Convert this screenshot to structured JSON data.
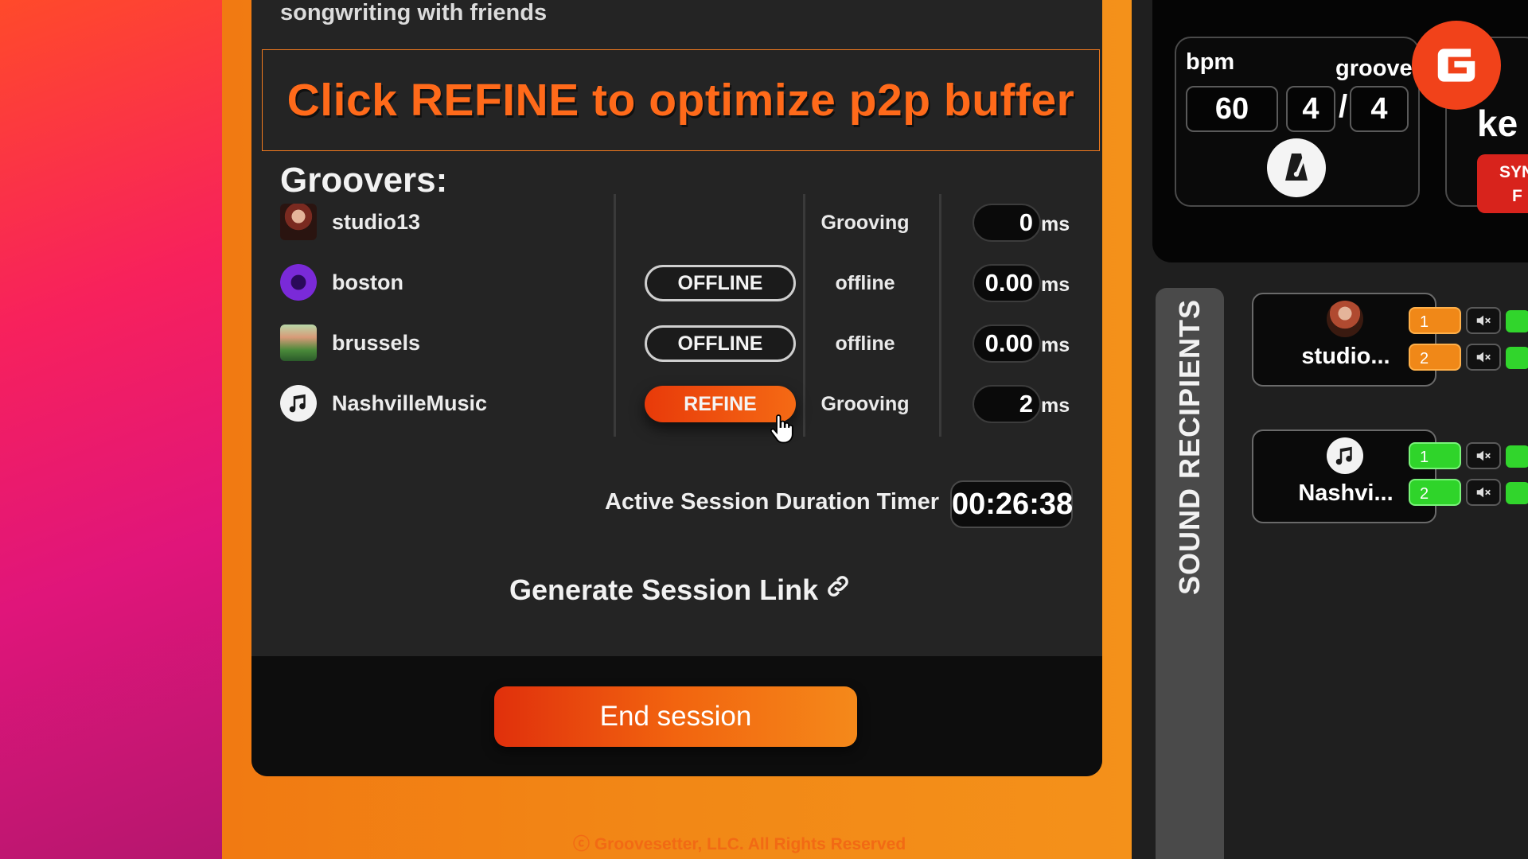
{
  "session": {
    "subtitle": "songwriting with friends",
    "banner": "Click REFINE to optimize p2p buffer",
    "groovers_heading": "Groovers:",
    "groovers": [
      {
        "name": "studio13",
        "button": "",
        "status": "Grooving",
        "latency": "0",
        "unit": "ms",
        "avatar": "photo-avatar"
      },
      {
        "name": "boston",
        "button": "OFFLINE",
        "status": "offline",
        "latency": "0.00",
        "unit": "ms",
        "avatar": "logo-avatar"
      },
      {
        "name": "brussels",
        "button": "OFFLINE",
        "status": "offline",
        "latency": "0.00",
        "unit": "ms",
        "avatar": "photo-avatar"
      },
      {
        "name": "NashvilleMusic",
        "button": "REFINE",
        "status": "Grooving",
        "latency": "2",
        "unit": "ms",
        "avatar": "music-note-icon"
      }
    ],
    "timer_label": "Active Session Duration Timer",
    "timer_value": "00:26:38",
    "session_link_label": "Generate Session Link",
    "end_session_label": "End session",
    "copyright": "ⓒ Groovesetter, LLC.  All Rights Reserved"
  },
  "tempo": {
    "bpm_label": "bpm",
    "bpm_value": "60",
    "groove_label": "groove",
    "beats": "4",
    "slash": "/",
    "note_value": "4",
    "metronome_icon": "metronome-icon"
  },
  "side_card": {
    "title": "ke",
    "sync_label_1": "SYN",
    "sync_label_2": "F"
  },
  "sound_recipients": {
    "title": "SOUND  RECIPIENTS",
    "recipients": [
      {
        "name": "studio...",
        "channels": [
          {
            "num": "1",
            "color": "orange"
          },
          {
            "num": "2",
            "color": "orange"
          }
        ]
      },
      {
        "name": "Nashvi...",
        "channels": [
          {
            "num": "1",
            "color": "green"
          },
          {
            "num": "2",
            "color": "green"
          }
        ]
      }
    ]
  },
  "colors": {
    "accent_orange": "#f27a1e",
    "banner_text": "#ff6a1a",
    "refine_red": "#e83a0a",
    "logo_red": "#f1421a",
    "channel_green": "#2fd42a"
  }
}
